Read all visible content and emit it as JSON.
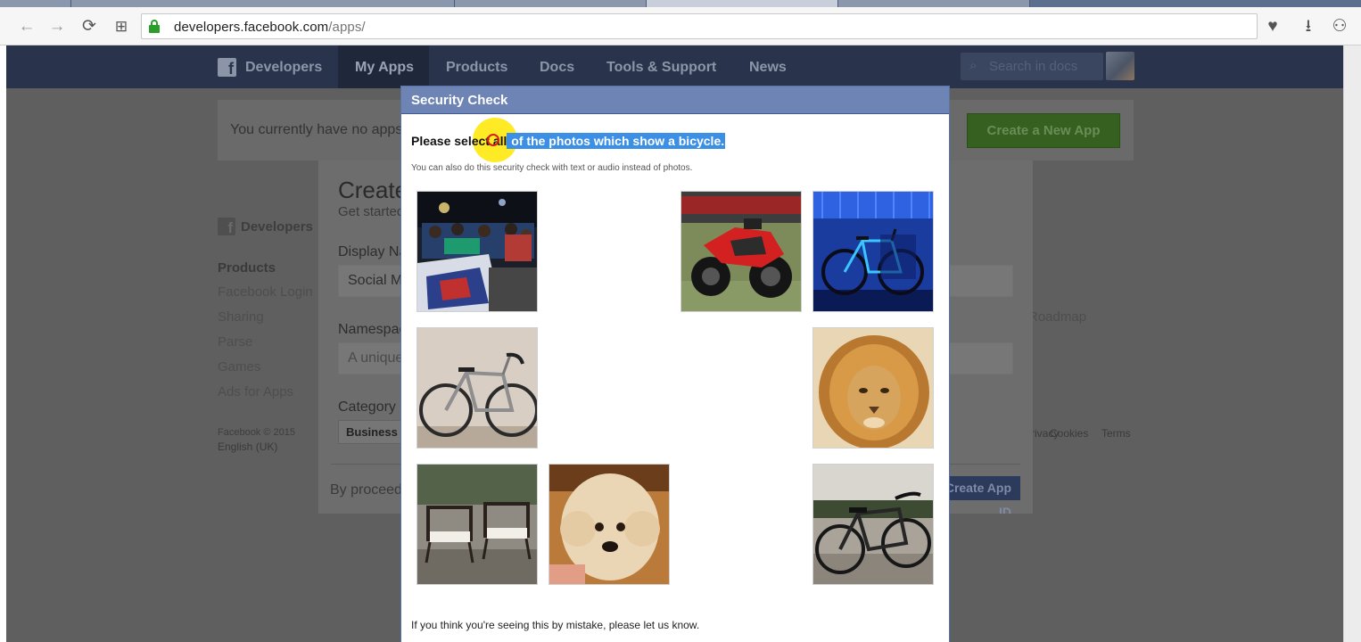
{
  "browser": {
    "url_host": "developers.facebook.com",
    "url_path": "/apps/",
    "back_icon": "←",
    "forward_icon": "→",
    "reload_icon": "⟳",
    "apps_icon": "⊞",
    "bookmark_icon": "♥",
    "download_icon": "⭳",
    "account_icon": "⚇"
  },
  "fb_nav": {
    "logo": "f",
    "brand": "Developers",
    "items": [
      "My Apps",
      "Products",
      "Docs",
      "Tools & Support",
      "News"
    ],
    "search_icon": "⌕",
    "search_placeholder": "Search in docs"
  },
  "banner": {
    "text": "You currently have no apps",
    "create_button": "Create a New App"
  },
  "footer_left": {
    "brand": "Developers",
    "heading": "Products",
    "links": [
      "Facebook Login",
      "Sharing",
      "Parse",
      "Games",
      "Ads for Apps"
    ],
    "copyright": "Facebook © 2015",
    "language": "English (UK)"
  },
  "footer_right": {
    "roadmap": "Roadmap",
    "links": [
      "Privacy",
      "Cookies",
      "Terms"
    ]
  },
  "create_modal": {
    "title": "Create a New App ID",
    "subtitle": "Get started integrating Facebook into your app or website",
    "display_name_label": "Display Name",
    "display_name_value": "Social M",
    "namespace_label": "Namespace",
    "namespace_placeholder": "A unique",
    "category_label": "Category",
    "category_value": "Business",
    "proceed_text": "By proceeding",
    "create_id_button": "Create App ID"
  },
  "security_check": {
    "title": "Security Check",
    "instruction_prefix": "Please select all",
    "instruction_highlight": " of the photos which show a bicycle.",
    "subtext": "You can also do this security check with text or audio instead of photos.",
    "footer_prefix": "If you think you're seeing this by mistake, please ",
    "footer_link": "let us know",
    "footer_suffix": ".",
    "photos": [
      {
        "subject": "crowd-with-motorbikes"
      },
      {
        "subject": "red-motorcycle"
      },
      {
        "subject": "bicycle-blue-light"
      },
      {
        "subject": "road-bicycle"
      },
      {
        "subject": "lion"
      },
      {
        "subject": "garden-chairs"
      },
      {
        "subject": "poodle-dog"
      },
      {
        "subject": "city-bicycle"
      }
    ]
  },
  "colors": {
    "fb_header": "#6d84b4",
    "highlight": "#3b8fe5",
    "create_btn": "#35601f"
  }
}
